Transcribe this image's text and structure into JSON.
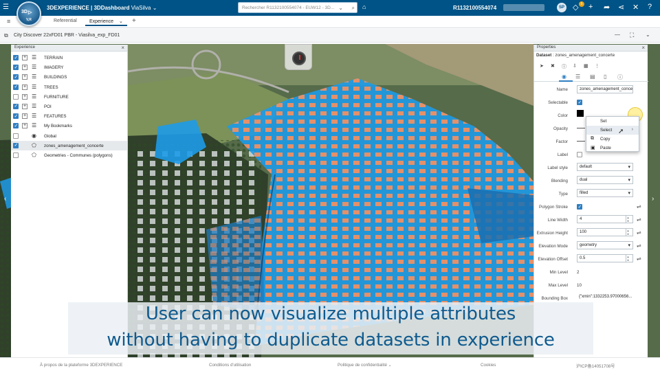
{
  "topbar": {
    "brand_bold": "3DEXPERIENCE | 3DDashboard",
    "brand_tenant": "ViaSilva ⌄",
    "compass_labels": [
      "3D",
      "▷",
      "V,R"
    ],
    "search_placeholder": "Rechercher R1132100554074 - EUW12 - 3D...",
    "user_id": "R1132100554074",
    "avatar_initials": "SP",
    "notification_count": "5",
    "icons": [
      "tag-icon",
      "share-flow-icon",
      "plus-icon",
      "forward-icon",
      "share-icon",
      "tools-icon",
      "help-icon"
    ]
  },
  "tabs": {
    "referential": "Referential",
    "experience": "Experience",
    "experience_caret": "⌄"
  },
  "appbar": {
    "title": "City Discover 22xFD01 PBR - Viasilva_exp_FD01"
  },
  "experience_panel": {
    "title": "Experience",
    "items": [
      {
        "label": "TERRAIN",
        "checked": true,
        "expand": true,
        "icon": "layers-icon"
      },
      {
        "label": "IMAGERY",
        "checked": true,
        "expand": true,
        "icon": "layers-icon"
      },
      {
        "label": "BUILDINGS",
        "checked": true,
        "expand": true,
        "icon": "layers-icon"
      },
      {
        "label": "TREES",
        "checked": true,
        "expand": true,
        "icon": "layers-icon"
      },
      {
        "label": "FURNITURE",
        "checked": false,
        "expand": true,
        "icon": "layers-icon"
      },
      {
        "label": "POI",
        "checked": true,
        "expand": true,
        "icon": "layers-icon"
      },
      {
        "label": "FEATURES",
        "checked": true,
        "expand": true,
        "icon": "layers-icon"
      },
      {
        "label": "My Bookmarks",
        "checked": true,
        "expand": true,
        "icon": "layers-icon"
      },
      {
        "label": "Global",
        "checked": false,
        "expand": false,
        "icon": "globe-icon"
      },
      {
        "label": "zones_amenagement_concerte",
        "checked": true,
        "expand": false,
        "icon": "polygon-icon"
      },
      {
        "label": "Geometries - Communes (polygons)",
        "checked": false,
        "expand": false,
        "icon": "polygon-icon"
      }
    ]
  },
  "properties_panel": {
    "title": "Properties",
    "dataset_label": "Dataset",
    "dataset_name": ": zones_amenagement_concerte",
    "fields": {
      "name_label": "Name",
      "name_value": "zones_amenagement_conce",
      "selectable_label": "Selectable",
      "color_label": "Color",
      "opacity_label": "Opacity",
      "factor_label": "Factor",
      "label_label": "Label",
      "label_style_label": "Label style",
      "label_style_value": "default",
      "blending_label": "Blending",
      "blending_value": "dual",
      "type_label": "Type",
      "type_value": "filled",
      "polygon_stroke_label": "Polygon Stroke",
      "line_width_label": "Line Width",
      "line_width_value": "4",
      "extrusion_height_label": "Extrusion Height",
      "extrusion_height_value": "100",
      "elevation_mode_label": "Elevation Mode",
      "elevation_mode_value": "geometry",
      "elevation_offset_label": "Elevation Offset",
      "elevation_offset_value": "0.5",
      "min_level_label": "Min Level",
      "min_level_value": "2",
      "max_level_label": "Max Level",
      "max_level_value": "10",
      "bounding_box_label": "Bounding Box",
      "bounding_box_value": "{\"xmin\":1332253.97000656..."
    },
    "selectable_checked": true,
    "label_checked": false,
    "polygon_stroke_checked": true,
    "color_value": "#000000"
  },
  "context_menu": {
    "items": [
      "Set",
      "Select",
      "Copy",
      "Paste"
    ]
  },
  "caption": {
    "line1": "User can now visualize multiple attributes",
    "line2": "without having to duplicate datasets in experience"
  },
  "footer": {
    "about": "À propos de la plateforme 3DEXPERIENCE",
    "terms": "Conditions d'utilisation",
    "privacy": "Politique de confidentialité ⌄",
    "cookies": "Cookies",
    "icp": "沪ICP备14051708号"
  },
  "colors": {
    "topbar": "#005386",
    "zone_fill": "#1e9be8",
    "accent": "#2f7fc1",
    "caption_text": "#0f5a8e"
  }
}
